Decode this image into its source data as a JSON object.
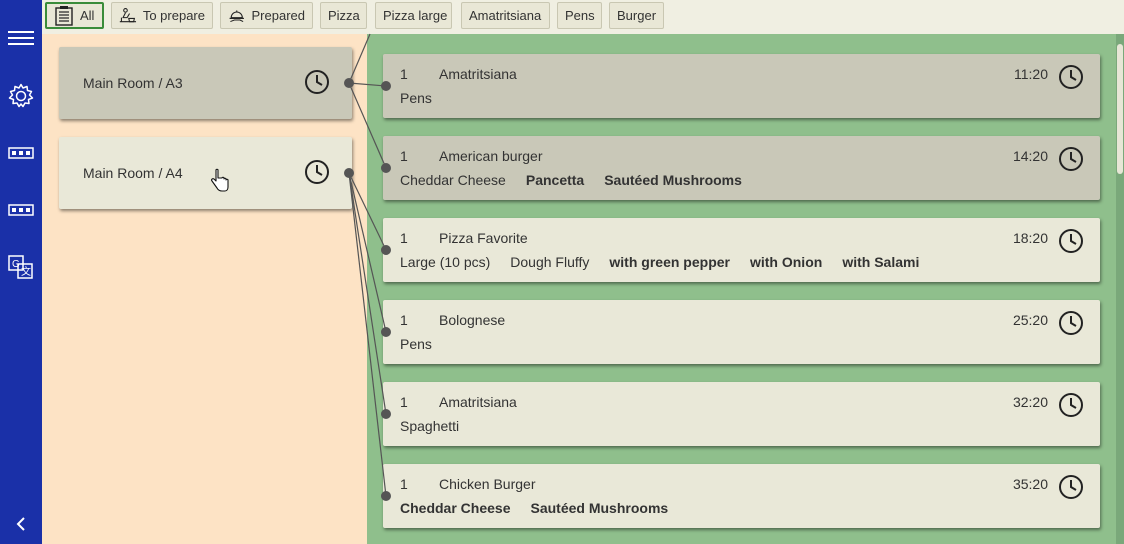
{
  "filters": [
    {
      "label": "All",
      "icon": "list-icon",
      "active": true
    },
    {
      "label": "To prepare",
      "icon": "cook-icon",
      "active": false
    },
    {
      "label": "Prepared",
      "icon": "served-dish-icon",
      "active": false
    },
    {
      "label": "Pizza",
      "active": false
    },
    {
      "label": "Pizza large",
      "active": false
    },
    {
      "label": "Amatritsiana",
      "active": false
    },
    {
      "label": "Pens",
      "active": false
    },
    {
      "label": "Burger",
      "active": false
    }
  ],
  "sidebar": {
    "items": [
      "menu-icon",
      "settings-icon",
      "ticket-icon",
      "ticket-icon",
      "translate-icon"
    ],
    "collapse": "chevron-left-icon"
  },
  "tables": [
    {
      "label": "Main Room / A3",
      "selected": true
    },
    {
      "label": "Main Room / A4",
      "selected": false
    }
  ],
  "orders": [
    {
      "qty": "1",
      "dish": "Amatritsiana",
      "time": "11:20",
      "done": true,
      "mods": [
        {
          "text": "Pens",
          "bold": false
        }
      ]
    },
    {
      "qty": "1",
      "dish": "American burger",
      "time": "14:20",
      "done": true,
      "mods": [
        {
          "text": "Cheddar Cheese",
          "bold": false
        },
        {
          "text": "Pancetta",
          "bold": true
        },
        {
          "text": "Sautéed Mushrooms",
          "bold": true
        }
      ]
    },
    {
      "qty": "1",
      "dish": "Pizza Favorite",
      "time": "18:20",
      "done": false,
      "mods": [
        {
          "text": "Large (10 pcs)",
          "bold": false
        },
        {
          "text": "Dough Fluffy",
          "bold": false
        },
        {
          "text": "with green pepper",
          "bold": true
        },
        {
          "text": "with Onion",
          "bold": true
        },
        {
          "text": "with Salami",
          "bold": true
        }
      ]
    },
    {
      "qty": "1",
      "dish": "Bolognese",
      "time": "25:20",
      "done": false,
      "mods": [
        {
          "text": "Pens",
          "bold": false
        }
      ]
    },
    {
      "qty": "1",
      "dish": "Amatritsiana",
      "time": "32:20",
      "done": false,
      "mods": [
        {
          "text": "Spaghetti",
          "bold": false
        }
      ]
    },
    {
      "qty": "1",
      "dish": "Chicken Burger",
      "time": "35:20",
      "done": false,
      "mods": [
        {
          "text": "Cheddar Cheese",
          "bold": true
        },
        {
          "text": "Sautéed Mushrooms",
          "bold": true
        }
      ]
    }
  ],
  "colors": {
    "sidebar": "#1a30a8",
    "left_panel": "#fde3c5",
    "right_panel": "#8fbf8c",
    "card_done": "#c9c8b8",
    "card_pending": "#e9e8d8",
    "active_filter_border": "#3a8c3a"
  }
}
